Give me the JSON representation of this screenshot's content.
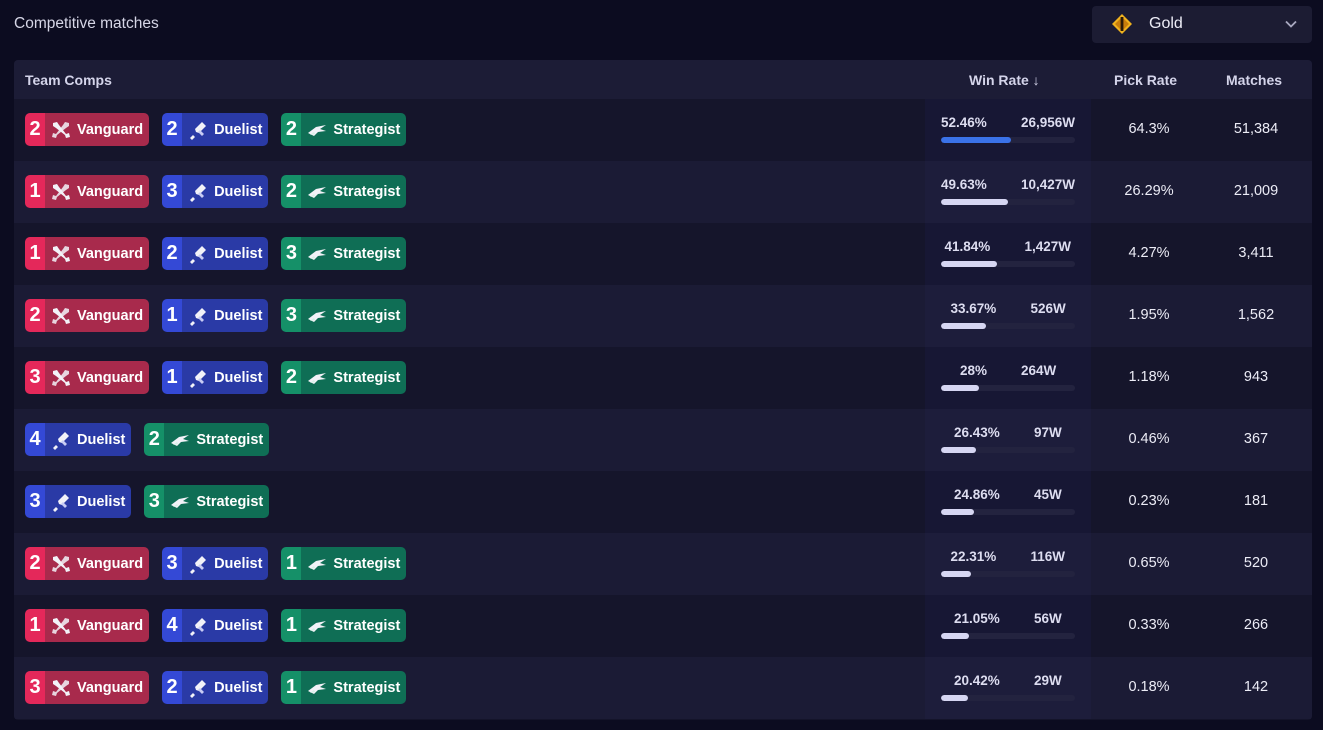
{
  "header": {
    "title": "Competitive matches",
    "rank_filter": {
      "selected": "Gold",
      "icon": "gold-rank-icon"
    }
  },
  "table": {
    "columns": {
      "team_comps": "Team Comps",
      "win_rate": "Win Rate ↓",
      "pick_rate": "Pick Rate",
      "matches": "Matches"
    },
    "rows": [
      {
        "roles": [
          {
            "count": "2",
            "role": "Vanguard"
          },
          {
            "count": "2",
            "role": "Duelist"
          },
          {
            "count": "2",
            "role": "Strategist"
          }
        ],
        "win_rate": "52.46%",
        "win_rate_value": 52.46,
        "wins": "26,956W",
        "pick_rate": "64.3%",
        "matches": "51,384"
      },
      {
        "roles": [
          {
            "count": "1",
            "role": "Vanguard"
          },
          {
            "count": "3",
            "role": "Duelist"
          },
          {
            "count": "2",
            "role": "Strategist"
          }
        ],
        "win_rate": "49.63%",
        "win_rate_value": 49.63,
        "wins": "10,427W",
        "pick_rate": "26.29%",
        "matches": "21,009"
      },
      {
        "roles": [
          {
            "count": "1",
            "role": "Vanguard"
          },
          {
            "count": "2",
            "role": "Duelist"
          },
          {
            "count": "3",
            "role": "Strategist"
          }
        ],
        "win_rate": "41.84%",
        "win_rate_value": 41.84,
        "wins": "1,427W",
        "pick_rate": "4.27%",
        "matches": "3,411"
      },
      {
        "roles": [
          {
            "count": "2",
            "role": "Vanguard"
          },
          {
            "count": "1",
            "role": "Duelist"
          },
          {
            "count": "3",
            "role": "Strategist"
          }
        ],
        "win_rate": "33.67%",
        "win_rate_value": 33.67,
        "wins": "526W",
        "pick_rate": "1.95%",
        "matches": "1,562"
      },
      {
        "roles": [
          {
            "count": "3",
            "role": "Vanguard"
          },
          {
            "count": "1",
            "role": "Duelist"
          },
          {
            "count": "2",
            "role": "Strategist"
          }
        ],
        "win_rate": "28%",
        "win_rate_value": 28,
        "wins": "264W",
        "pick_rate": "1.18%",
        "matches": "943"
      },
      {
        "roles": [
          {
            "count": "4",
            "role": "Duelist"
          },
          {
            "count": "2",
            "role": "Strategist"
          }
        ],
        "win_rate": "26.43%",
        "win_rate_value": 26.43,
        "wins": "97W",
        "pick_rate": "0.46%",
        "matches": "367"
      },
      {
        "roles": [
          {
            "count": "3",
            "role": "Duelist"
          },
          {
            "count": "3",
            "role": "Strategist"
          }
        ],
        "win_rate": "24.86%",
        "win_rate_value": 24.86,
        "wins": "45W",
        "pick_rate": "0.23%",
        "matches": "181"
      },
      {
        "roles": [
          {
            "count": "2",
            "role": "Vanguard"
          },
          {
            "count": "3",
            "role": "Duelist"
          },
          {
            "count": "1",
            "role": "Strategist"
          }
        ],
        "win_rate": "22.31%",
        "win_rate_value": 22.31,
        "wins": "116W",
        "pick_rate": "0.65%",
        "matches": "520"
      },
      {
        "roles": [
          {
            "count": "1",
            "role": "Vanguard"
          },
          {
            "count": "4",
            "role": "Duelist"
          },
          {
            "count": "1",
            "role": "Strategist"
          }
        ],
        "win_rate": "21.05%",
        "win_rate_value": 21.05,
        "wins": "56W",
        "pick_rate": "0.33%",
        "matches": "266"
      },
      {
        "roles": [
          {
            "count": "3",
            "role": "Vanguard"
          },
          {
            "count": "2",
            "role": "Duelist"
          },
          {
            "count": "1",
            "role": "Strategist"
          }
        ],
        "win_rate": "20.42%",
        "win_rate_value": 20.42,
        "wins": "29W",
        "pick_rate": "0.18%",
        "matches": "142"
      }
    ]
  },
  "role_icons": {
    "Vanguard": "vanguard-icon",
    "Duelist": "duelist-icon",
    "Strategist": "strategist-icon"
  },
  "colors": {
    "vanguard": "#e4285a",
    "duelist": "#3449d6",
    "strategist": "#159068",
    "top_bar": "#3a72e8",
    "gold": "#f0b21e"
  }
}
